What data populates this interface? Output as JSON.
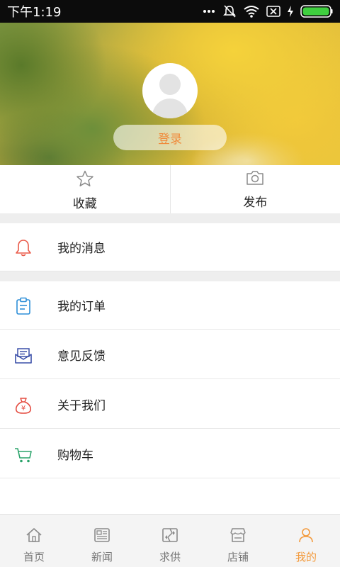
{
  "status_bar": {
    "time": "下午1:19",
    "icons": [
      "more-dots-icon",
      "mute-icon",
      "wifi-icon",
      "sim-off-icon",
      "charging-icon",
      "battery-icon"
    ]
  },
  "profile": {
    "login_label": "登录"
  },
  "quick_actions": [
    {
      "label": "收藏",
      "icon": "star-icon"
    },
    {
      "label": "发布",
      "icon": "camera-icon"
    }
  ],
  "menu": {
    "messages": {
      "label": "我的消息",
      "icon": "bell-icon",
      "color": "#ea5b4a"
    },
    "orders": {
      "label": "我的订单",
      "icon": "clipboard-icon",
      "color": "#2f8fd8"
    },
    "feedback": {
      "label": "意见反馈",
      "icon": "mail-icon",
      "color": "#3a4fa8"
    },
    "about": {
      "label": "关于我们",
      "icon": "money-bag-icon",
      "color": "#e44a3f"
    },
    "cart": {
      "label": "购物车",
      "icon": "cart-icon",
      "color": "#2aa36a"
    }
  },
  "bottom_nav": [
    {
      "label": "首页",
      "icon": "home-icon",
      "active": false
    },
    {
      "label": "新闻",
      "icon": "news-icon",
      "active": false
    },
    {
      "label": "求供",
      "icon": "supply-icon",
      "active": false
    },
    {
      "label": "店铺",
      "icon": "shop-icon",
      "active": false
    },
    {
      "label": "我的",
      "icon": "user-icon",
      "active": true
    }
  ],
  "colors": {
    "accent": "#f39a3c",
    "inactive_nav": "#777777",
    "section_gap": "#eeeeee"
  }
}
